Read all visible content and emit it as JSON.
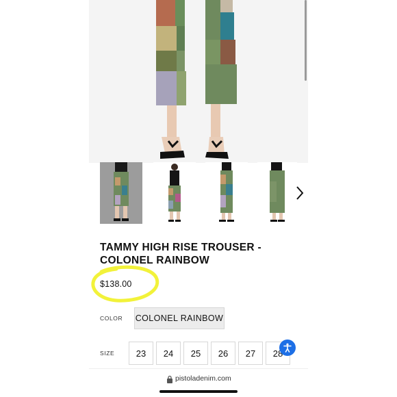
{
  "product": {
    "title": "TAMMY HIGH RISE TROUSER - COLONEL RAINBOW",
    "price": "$138.00"
  },
  "options": {
    "color_label": "COLOR",
    "color_value": "COLONEL RAINBOW",
    "size_label": "SIZE",
    "sizes": [
      "23",
      "24",
      "25",
      "26",
      "27",
      "28"
    ]
  },
  "browser": {
    "url": "pistoladenim.com"
  },
  "colors": {
    "highlight": "#f2f23a",
    "accessibility": "#1d6fe6",
    "trouser_green": "#6f8a5e"
  },
  "icons": {
    "next": "chevron-right-icon",
    "lock": "lock-icon",
    "accessibility": "accessibility-icon"
  }
}
